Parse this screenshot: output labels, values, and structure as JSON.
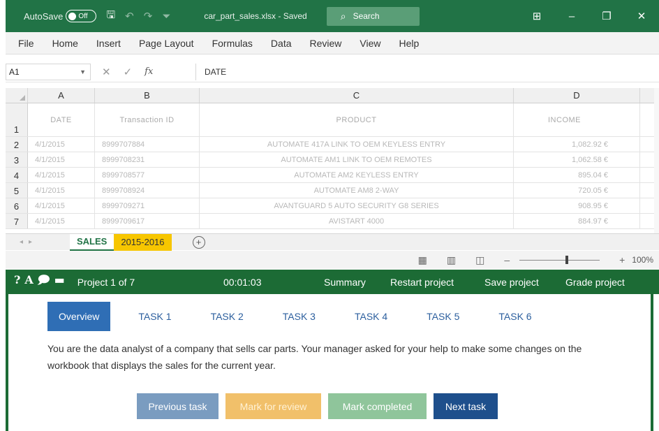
{
  "titlebar": {
    "autosave_label": "AutoSave",
    "autosave_state": "Off",
    "filename": "car_part_sales.xlsx - Saved",
    "search_label": "Search"
  },
  "menu": [
    "File",
    "Home",
    "Insert",
    "Page Layout",
    "Formulas",
    "Data",
    "Review",
    "View",
    "Help"
  ],
  "formula_bar": {
    "name_box": "A1",
    "formula": "DATE"
  },
  "grid": {
    "columns": [
      "A",
      "B",
      "C",
      "D"
    ],
    "rows": [
      {
        "num": "1",
        "cells": [
          "DATE",
          "Transaction ID",
          "PRODUCT",
          "INCOME"
        ]
      },
      {
        "num": "2",
        "cells": [
          "4/1/2015",
          "8999707884",
          "AUTOMATE 417A LINK TO OEM KEYLESS ENTRY",
          "1,082.92 €"
        ]
      },
      {
        "num": "3",
        "cells": [
          "4/1/2015",
          "8999708231",
          "AUTOMATE AM1 LINK TO OEM REMOTES",
          "1,062.58 €"
        ]
      },
      {
        "num": "4",
        "cells": [
          "4/1/2015",
          "8999708577",
          "AUTOMATE AM2 KEYLESS ENTRY",
          "895.04 €"
        ]
      },
      {
        "num": "5",
        "cells": [
          "4/1/2015",
          "8999708924",
          "AUTOMATE AM8 2-WAY",
          "720.05 €"
        ]
      },
      {
        "num": "6",
        "cells": [
          "4/1/2015",
          "8999709271",
          "AVANTGUARD 5 AUTO SECURITY G8 SERIES",
          "908.95 €"
        ]
      },
      {
        "num": "7",
        "cells": [
          "4/1/2015",
          "8999709617",
          "AVISTART 4000",
          "884.97 €"
        ]
      }
    ]
  },
  "sheets": [
    "SALES",
    "2015-2016"
  ],
  "statusbar": {
    "zoom": "100%"
  },
  "exambar": {
    "project": "Project 1 of 7",
    "timer": "00:01:03",
    "summary": "Summary",
    "restart": "Restart project",
    "save": "Save project",
    "grade": "Grade project"
  },
  "tasks": {
    "tabs": [
      "Overview",
      "TASK 1",
      "TASK 2",
      "TASK 3",
      "TASK 4",
      "TASK 5",
      "TASK 6"
    ],
    "description": "You are the data analyst of a company that sells car parts. Your manager asked for your help to make some changes on the workbook that displays the sales for the current year.",
    "buttons": {
      "previous": "Previous task",
      "mark_review": "Mark for review",
      "mark_completed": "Mark completed",
      "next": "Next task"
    }
  }
}
